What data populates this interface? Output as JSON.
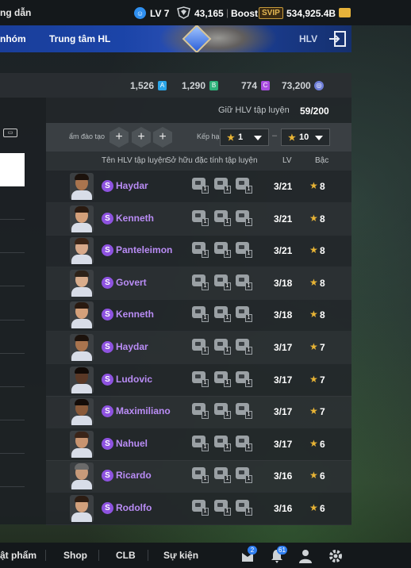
{
  "topbar": {
    "guide": "ng dẫn",
    "level": "LV 7",
    "points": "43,165",
    "boost_label": "Boost",
    "svip": "SVIP",
    "coins": "534,925.4B"
  },
  "nav": {
    "item_left": "nhóm",
    "item_center": "Trung tâm HL",
    "item_right": "HLV"
  },
  "currencies": [
    {
      "value": "1,526",
      "icon": "A",
      "color": "#2aa5e8"
    },
    {
      "value": "1,290",
      "icon": "B",
      "color": "#2fb27a"
    },
    {
      "value": "774",
      "icon": "C",
      "color": "#a94ce0"
    },
    {
      "value": "73,200",
      "icon": "coin-icon",
      "color": "#6f7fd8"
    }
  ],
  "coaches": {
    "keep_label": "Giữ HLV tập luyện",
    "keep_value": "59/200",
    "filter_label": "ẩm đào tạo",
    "grade_label": "Kếp hạ",
    "grade_from": "1",
    "grade_to": "10",
    "dash": "–",
    "columns": {
      "name": "Tên HLV tập luyện",
      "traits": "Sở hữu đặc tính tập luyện",
      "lv": "LV",
      "grade": "Bậc"
    },
    "rows": [
      {
        "name": "Haydar",
        "badge": "S",
        "lv": "3/21",
        "grade": "8",
        "skin": "#a9744e",
        "hair": "#1c120c"
      },
      {
        "name": "Kenneth",
        "badge": "S",
        "lv": "3/21",
        "grade": "8",
        "skin": "#d4a07a",
        "hair": "#2a1a10"
      },
      {
        "name": "Panteleimon",
        "badge": "S",
        "lv": "3/21",
        "grade": "8",
        "skin": "#d8a98a",
        "hair": "#3b2416"
      },
      {
        "name": "Govert",
        "badge": "S",
        "lv": "3/18",
        "grade": "8",
        "skin": "#d9ad8c",
        "hair": "#2e2218"
      },
      {
        "name": "Kenneth",
        "badge": "S",
        "lv": "3/18",
        "grade": "8",
        "skin": "#d4a07a",
        "hair": "#2a1a10"
      },
      {
        "name": "Haydar",
        "badge": "S",
        "lv": "3/17",
        "grade": "7",
        "skin": "#a9744e",
        "hair": "#1c120c"
      },
      {
        "name": "Ludovic",
        "badge": "S",
        "lv": "3/17",
        "grade": "7",
        "skin": "#5a3826",
        "hair": "#120a06"
      },
      {
        "name": "Maximiliano",
        "badge": "S",
        "lv": "3/17",
        "grade": "7",
        "skin": "#8a5a3a",
        "hair": "#140c08"
      },
      {
        "name": "Nahuel",
        "badge": "S",
        "lv": "3/17",
        "grade": "6",
        "skin": "#c89470",
        "hair": "#3a2418"
      },
      {
        "name": "Ricardo",
        "badge": "S",
        "lv": "3/16",
        "grade": "6",
        "skin": "#c79a7a",
        "hair": "#6a6a6a"
      },
      {
        "name": "Rodolfo",
        "badge": "S",
        "lv": "3/16",
        "grade": "6",
        "skin": "#d2a07c",
        "hair": "#2c1c12"
      }
    ],
    "trait_count": "1"
  },
  "bottom": {
    "item1": "ật phẩm",
    "item2": "Shop",
    "item3": "CLB",
    "item4": "Sự kiện",
    "notif1": "2",
    "notif2": "61"
  }
}
